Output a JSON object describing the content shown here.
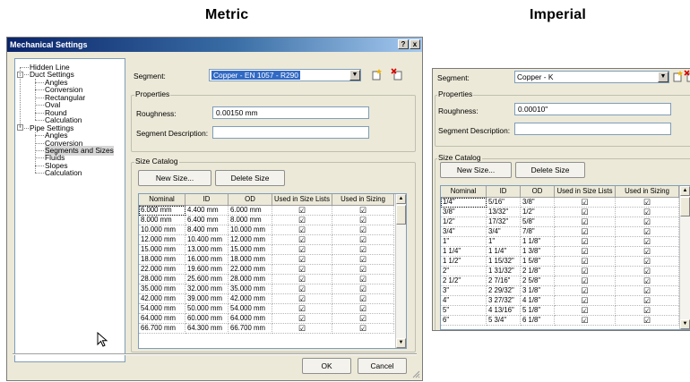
{
  "headings": {
    "metric": "Metric",
    "imperial": "Imperial"
  },
  "metric": {
    "title": "Mechanical Settings",
    "help_label": "?",
    "close_label": "x",
    "tree": [
      {
        "label": "Hidden Line"
      },
      {
        "label": "Duct Settings",
        "expander": "-"
      },
      {
        "label": "Angles"
      },
      {
        "label": "Conversion"
      },
      {
        "label": "Rectangular"
      },
      {
        "label": "Oval"
      },
      {
        "label": "Round"
      },
      {
        "label": "Calculation"
      },
      {
        "label": "Pipe Settings",
        "expander": "-"
      },
      {
        "label": "Angles"
      },
      {
        "label": "Conversion"
      },
      {
        "label": "Segments and Sizes",
        "selected": true
      },
      {
        "label": "Fluids"
      },
      {
        "label": "Slopes"
      },
      {
        "label": "Calculation"
      }
    ],
    "segment_label": "Segment:",
    "segment_value": "Copper - EN 1057 - R290",
    "properties_label": "Properties",
    "roughness_label": "Roughness:",
    "roughness_value": "0.00150 mm",
    "segment_description_label": "Segment Description:",
    "segment_description_value": "",
    "size_catalog_label": "Size Catalog",
    "new_size_label": "New Size...",
    "delete_size_label": "Delete Size",
    "columns": [
      "Nominal",
      "ID",
      "OD",
      "Used in Size Lists",
      "Used in Sizing"
    ],
    "rows": [
      [
        "6.000 mm",
        "4.400 mm",
        "6.000 mm"
      ],
      [
        "8.000 mm",
        "6.400 mm",
        "8.000 mm"
      ],
      [
        "10.000 mm",
        "8.400 mm",
        "10.000 mm"
      ],
      [
        "12.000 mm",
        "10.400 mm",
        "12.000 mm"
      ],
      [
        "15.000 mm",
        "13.000 mm",
        "15.000 mm"
      ],
      [
        "18.000 mm",
        "16.000 mm",
        "18.000 mm"
      ],
      [
        "22.000 mm",
        "19.600 mm",
        "22.000 mm"
      ],
      [
        "28.000 mm",
        "25.600 mm",
        "28.000 mm"
      ],
      [
        "35.000 mm",
        "32.000 mm",
        "35.000 mm"
      ],
      [
        "42.000 mm",
        "39.000 mm",
        "42.000 mm"
      ],
      [
        "54.000 mm",
        "50.000 mm",
        "54.000 mm"
      ],
      [
        "64.000 mm",
        "60.000 mm",
        "64.000 mm"
      ],
      [
        "66.700 mm",
        "64.300 mm",
        "66.700 mm"
      ]
    ],
    "check_glyph": "☑",
    "ok_label": "OK",
    "cancel_label": "Cancel"
  },
  "imperial": {
    "segment_label": "Segment:",
    "segment_value": "Copper - K",
    "properties_label": "Properties",
    "roughness_label": "Roughness:",
    "roughness_value": "0.00010\"",
    "segment_description_label": "Segment Description:",
    "segment_description_value": "",
    "size_catalog_label": "Size Catalog",
    "new_size_label": "New Size...",
    "delete_size_label": "Delete Size",
    "columns": [
      "Nominal",
      "ID",
      "OD",
      "Used in Size Lists",
      "Used in Sizing"
    ],
    "rows": [
      [
        "1/4\"",
        "5/16\"",
        "3/8\""
      ],
      [
        "3/8\"",
        "13/32\"",
        "1/2\""
      ],
      [
        "1/2\"",
        "17/32\"",
        "5/8\""
      ],
      [
        "3/4\"",
        "3/4\"",
        "7/8\""
      ],
      [
        "1\"",
        "1\"",
        "1 1/8\""
      ],
      [
        "1 1/4\"",
        "1 1/4\"",
        "1 3/8\""
      ],
      [
        "1 1/2\"",
        "1 15/32\"",
        "1 5/8\""
      ],
      [
        "2\"",
        "1 31/32\"",
        "2 1/8\""
      ],
      [
        "2 1/2\"",
        "2 7/16\"",
        "2 5/8\""
      ],
      [
        "3\"",
        "2 29/32\"",
        "3 1/8\""
      ],
      [
        "4\"",
        "3 27/32\"",
        "4 1/8\""
      ],
      [
        "5\"",
        "4 13/16\"",
        "5 1/8\""
      ],
      [
        "6\"",
        "5 3/4\"",
        "6 1/8\""
      ]
    ],
    "check_glyph": "☑"
  }
}
